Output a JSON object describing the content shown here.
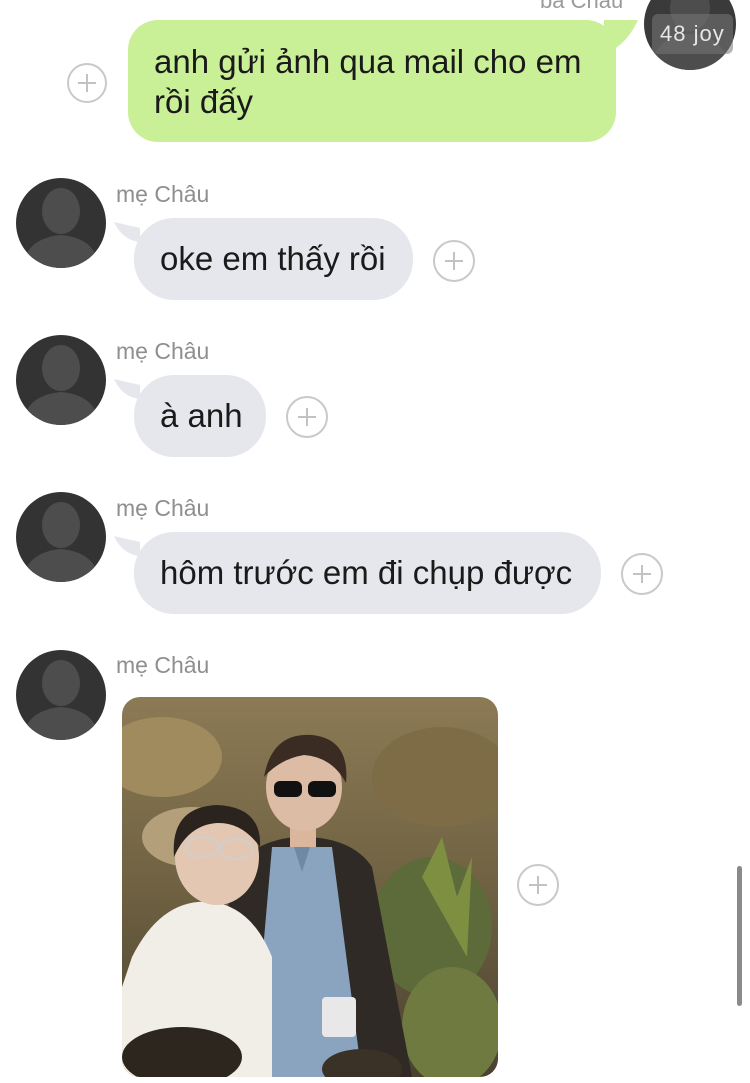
{
  "top": {
    "partial_sender": "bà Châu",
    "watermark": "48 joy"
  },
  "messages": [
    {
      "direction": "out",
      "text_line1": "anh gửi ảnh qua mail cho em",
      "text_line2": "rồi đấy"
    },
    {
      "direction": "in",
      "sender": "mẹ Châu",
      "text": "oke em thấy rồi"
    },
    {
      "direction": "in",
      "sender": "mẹ Châu",
      "text": "à anh"
    },
    {
      "direction": "in",
      "sender": "mẹ Châu",
      "text": "hôm trước em đi chụp được"
    },
    {
      "direction": "in",
      "sender": "mẹ Châu",
      "type": "image"
    }
  ],
  "colors": {
    "outgoing_bubble": "#c9ef97",
    "incoming_bubble": "#e5e7ec",
    "sender_name": "#8f8f8f",
    "avatar": "#333333"
  },
  "icons": {
    "add": "plus-circle-icon",
    "avatar": "default-person-icon"
  }
}
